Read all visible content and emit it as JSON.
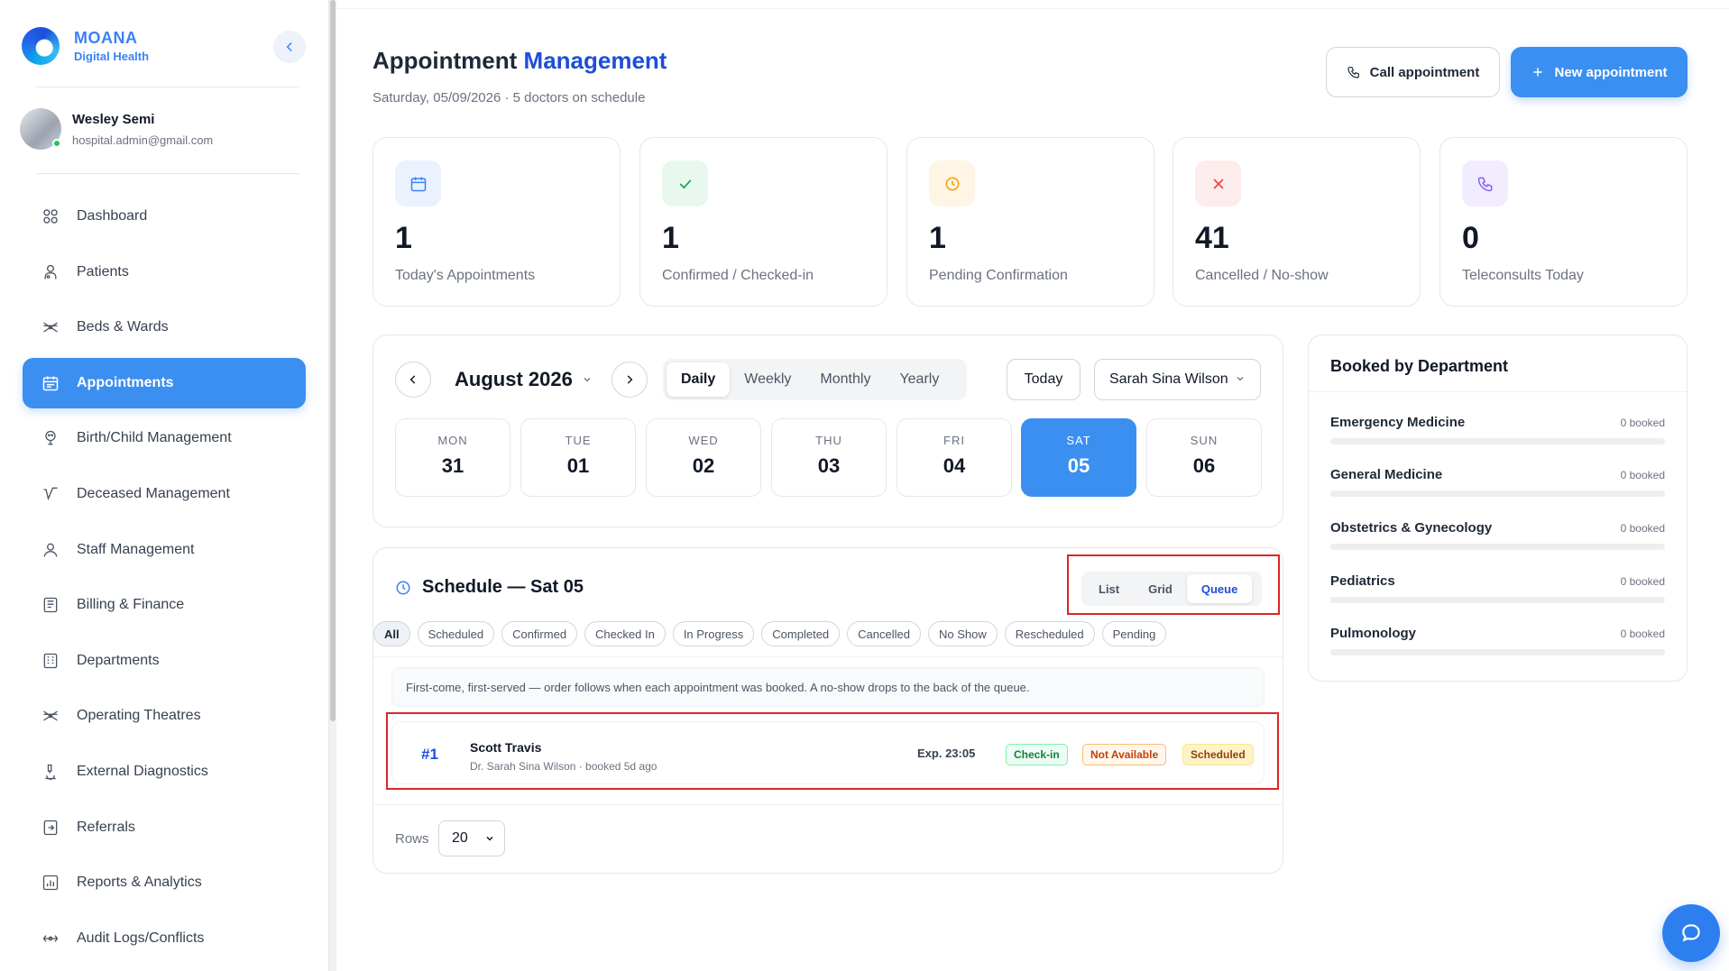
{
  "brand": {
    "name": "MOANA",
    "subtitle": "Digital Health"
  },
  "user": {
    "name": "Wesley Semi",
    "email": "hospital.admin@gmail.com",
    "status": "online"
  },
  "sidebar": {
    "items": [
      {
        "label": "Dashboard",
        "icon": "grid-icon"
      },
      {
        "label": "Patients",
        "icon": "patient-icon"
      },
      {
        "label": "Beds & Wards",
        "icon": "bed-icon"
      },
      {
        "label": "Appointments",
        "icon": "calendar-icon",
        "active": true
      },
      {
        "label": "Birth/Child Management",
        "icon": "baby-icon"
      },
      {
        "label": "Deceased Management",
        "icon": "deceased-icon"
      },
      {
        "label": "Staff Management",
        "icon": "staff-icon"
      },
      {
        "label": "Billing & Finance",
        "icon": "receipt-icon"
      },
      {
        "label": "Departments",
        "icon": "building-icon"
      },
      {
        "label": "Operating Theatres",
        "icon": "theatre-icon"
      },
      {
        "label": "External Diagnostics",
        "icon": "microscope-icon"
      },
      {
        "label": "Referrals",
        "icon": "referral-icon"
      },
      {
        "label": "Reports & Analytics",
        "icon": "analytics-icon"
      },
      {
        "label": "Audit Logs/Conflicts",
        "icon": "audit-icon"
      }
    ]
  },
  "header": {
    "title_part1": "Appointment",
    "title_part2": "Management",
    "subtitle": "Saturday, 05/09/2026 · 5 doctors on schedule",
    "call_button": "Call appointment",
    "new_button": "New appointment"
  },
  "stats": [
    {
      "value": "1",
      "label": "Today's Appointments",
      "icon": "calendar-icon",
      "color": "#3b82f6",
      "bg": "#eaf2fe"
    },
    {
      "value": "1",
      "label": "Confirmed / Checked-in",
      "icon": "check-icon",
      "color": "#16a34a",
      "bg": "#e8f8ee"
    },
    {
      "value": "1",
      "label": "Pending Confirmation",
      "icon": "clock-icon",
      "color": "#f59e0b",
      "bg": "#fef5e4"
    },
    {
      "value": "41",
      "label": "Cancelled / No-show",
      "icon": "x-icon",
      "color": "#ef4444",
      "bg": "#fdecec"
    },
    {
      "value": "0",
      "label": "Teleconsults Today",
      "icon": "phone-icon",
      "color": "#8b5cf6",
      "bg": "#f1ecfe"
    }
  ],
  "calendar": {
    "month": "August 2026",
    "views": [
      "Daily",
      "Weekly",
      "Monthly",
      "Yearly"
    ],
    "active_view": "Daily",
    "today_label": "Today",
    "doctor": "Sarah Sina Wilson",
    "days": [
      {
        "dow": "MON",
        "num": "31"
      },
      {
        "dow": "TUE",
        "num": "01"
      },
      {
        "dow": "WED",
        "num": "02"
      },
      {
        "dow": "THU",
        "num": "03"
      },
      {
        "dow": "FRI",
        "num": "04"
      },
      {
        "dow": "SAT",
        "num": "05",
        "active": true
      },
      {
        "dow": "SUN",
        "num": "06"
      }
    ]
  },
  "schedule": {
    "title": "Schedule — Sat 05",
    "layouts": [
      "List",
      "Grid",
      "Queue"
    ],
    "active_layout": "Queue",
    "filters": [
      "All",
      "Scheduled",
      "Confirmed",
      "Checked In",
      "In Progress",
      "Completed",
      "Cancelled",
      "No Show",
      "Rescheduled",
      "Pending"
    ],
    "active_filter": "All",
    "note": "First-come, first-served — order follows when each appointment was booked. A no-show drops to the back of the queue.",
    "queue": [
      {
        "number": "#1",
        "patient": "Scott Travis",
        "meta": "Dr. Sarah Sina Wilson · booked 5d ago",
        "expected": "Exp. 23:05",
        "checkin_label": "Check-in",
        "availability": "Not Available",
        "status": "Scheduled"
      }
    ],
    "rows_label": "Rows",
    "rows_value": "20"
  },
  "departments": {
    "title": "Booked by Department",
    "items": [
      {
        "name": "Emergency Medicine",
        "count": "0 booked",
        "fraction": 0
      },
      {
        "name": "General Medicine",
        "count": "0 booked",
        "fraction": 0
      },
      {
        "name": "Obstetrics & Gynecology",
        "count": "0 booked",
        "fraction": 0
      },
      {
        "name": "Pediatrics",
        "count": "0 booked",
        "fraction": 0
      },
      {
        "name": "Pulmonology",
        "count": "0 booked",
        "fraction": 0
      }
    ]
  },
  "colors": {
    "accent": "#3b8ff0",
    "highlight": "#dc2626"
  }
}
